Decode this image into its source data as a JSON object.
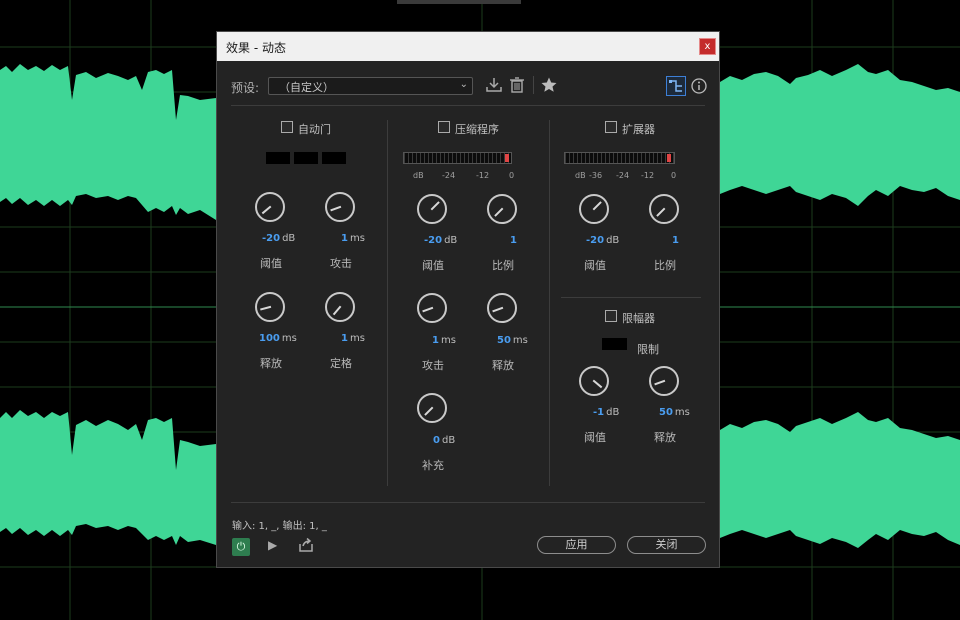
{
  "dialog": {
    "title": "效果 - 动态",
    "close_label": "x",
    "preset_label": "预设:",
    "preset_value": "（自定义）",
    "io_text": "输入: 1, _,   输出: 1, _",
    "apply_label": "应用",
    "close_button_label": "关闭"
  },
  "autogate": {
    "label": "自动门",
    "knobs": [
      {
        "value": "-20",
        "unit": "dB",
        "label": "阈值"
      },
      {
        "value": "1",
        "unit": "ms",
        "label": "攻击"
      },
      {
        "value": "100",
        "unit": "ms",
        "label": "释放"
      },
      {
        "value": "1",
        "unit": "ms",
        "label": "定格"
      }
    ]
  },
  "compressor": {
    "label": "压缩程序",
    "meter_scale": [
      "dB",
      "-24",
      "-12",
      "0"
    ],
    "knobs": [
      {
        "value": "-20",
        "unit": "dB",
        "label": "阈值"
      },
      {
        "value": "1",
        "unit": "",
        "label": "比例"
      },
      {
        "value": "1",
        "unit": "ms",
        "label": "攻击"
      },
      {
        "value": "50",
        "unit": "ms",
        "label": "释放"
      },
      {
        "value": "0",
        "unit": "dB",
        "label": "补充"
      }
    ]
  },
  "expander": {
    "label": "扩展器",
    "meter_scale": [
      "dB",
      "-36",
      "-24",
      "-12",
      "0"
    ],
    "knobs": [
      {
        "value": "-20",
        "unit": "dB",
        "label": "阈值"
      },
      {
        "value": "1",
        "unit": "",
        "label": "比例"
      }
    ]
  },
  "limiter": {
    "label": "限幅器",
    "limit_label": "限制",
    "knobs": [
      {
        "value": "-1",
        "unit": "dB",
        "label": "阈值"
      },
      {
        "value": "50",
        "unit": "ms",
        "label": "释放"
      }
    ]
  },
  "colors": {
    "accent": "#4a9df0",
    "waveform": "#3fd696",
    "power": "#2e7d4f",
    "peak": "#e04545"
  },
  "icons": [
    "save-preset-icon",
    "delete-preset-icon",
    "star-icon",
    "routing-icon",
    "info-icon",
    "power-icon",
    "play-icon",
    "export-icon"
  ]
}
